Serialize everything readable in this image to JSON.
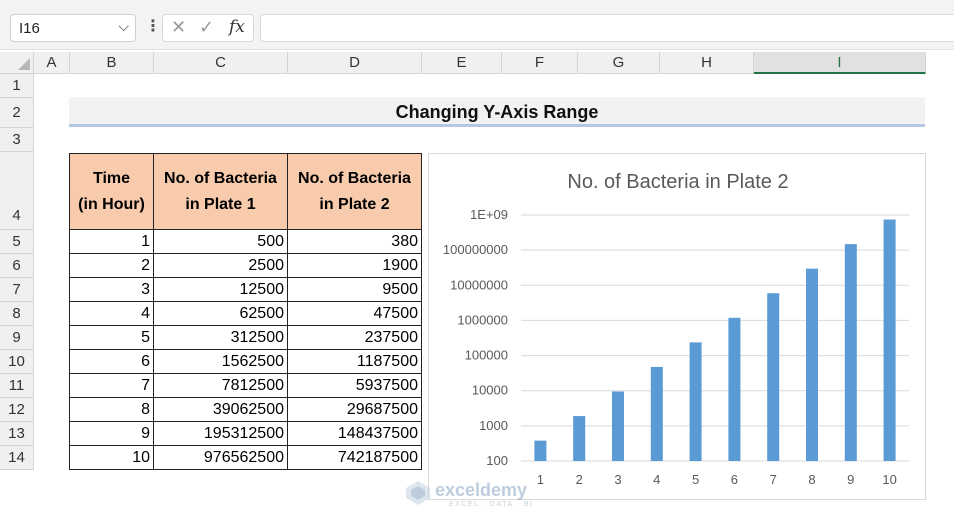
{
  "formula_bar": {
    "name_box": "I16",
    "cancel_glyph": "✕",
    "enter_glyph": "✓",
    "fx_label": "fx",
    "formula": ""
  },
  "columns": [
    "A",
    "B",
    "C",
    "D",
    "E",
    "F",
    "G",
    "H",
    "I"
  ],
  "selected_column": "I",
  "rows": [
    "1",
    "2",
    "3",
    "4",
    "5",
    "6",
    "7",
    "8",
    "9",
    "10",
    "11",
    "12",
    "13",
    "14"
  ],
  "sheet_title": "Changing Y-Axis Range",
  "table": {
    "headers": [
      [
        "Time",
        "(in Hour)"
      ],
      [
        "No. of Bacteria",
        "in Plate 1"
      ],
      [
        "No. of Bacteria",
        "in Plate 2"
      ]
    ],
    "rows": [
      [
        "1",
        "500",
        "380"
      ],
      [
        "2",
        "2500",
        "1900"
      ],
      [
        "3",
        "12500",
        "9500"
      ],
      [
        "4",
        "62500",
        "47500"
      ],
      [
        "5",
        "312500",
        "237500"
      ],
      [
        "6",
        "1562500",
        "1187500"
      ],
      [
        "7",
        "7812500",
        "5937500"
      ],
      [
        "8",
        "39062500",
        "29687500"
      ],
      [
        "9",
        "195312500",
        "148437500"
      ],
      [
        "10",
        "976562500",
        "742187500"
      ]
    ]
  },
  "chart_data": {
    "type": "bar",
    "title": "No. of Bacteria in Plate 2",
    "categories": [
      "1",
      "2",
      "3",
      "4",
      "5",
      "6",
      "7",
      "8",
      "9",
      "10"
    ],
    "values": [
      380,
      1900,
      9500,
      47500,
      237500,
      1187500,
      5937500,
      29687500,
      148437500,
      742187500
    ],
    "y_scale": "log",
    "ylim": [
      100,
      1000000000
    ],
    "y_tick_labels": [
      "100",
      "1000",
      "10000",
      "100000",
      "1000000",
      "10000000",
      "100000000",
      "1E+09"
    ],
    "grid": true,
    "bar_color": "#5b9bd5"
  },
  "watermark": {
    "brand": "exceldemy",
    "tagline": "EXCEL · DATA · BI"
  }
}
